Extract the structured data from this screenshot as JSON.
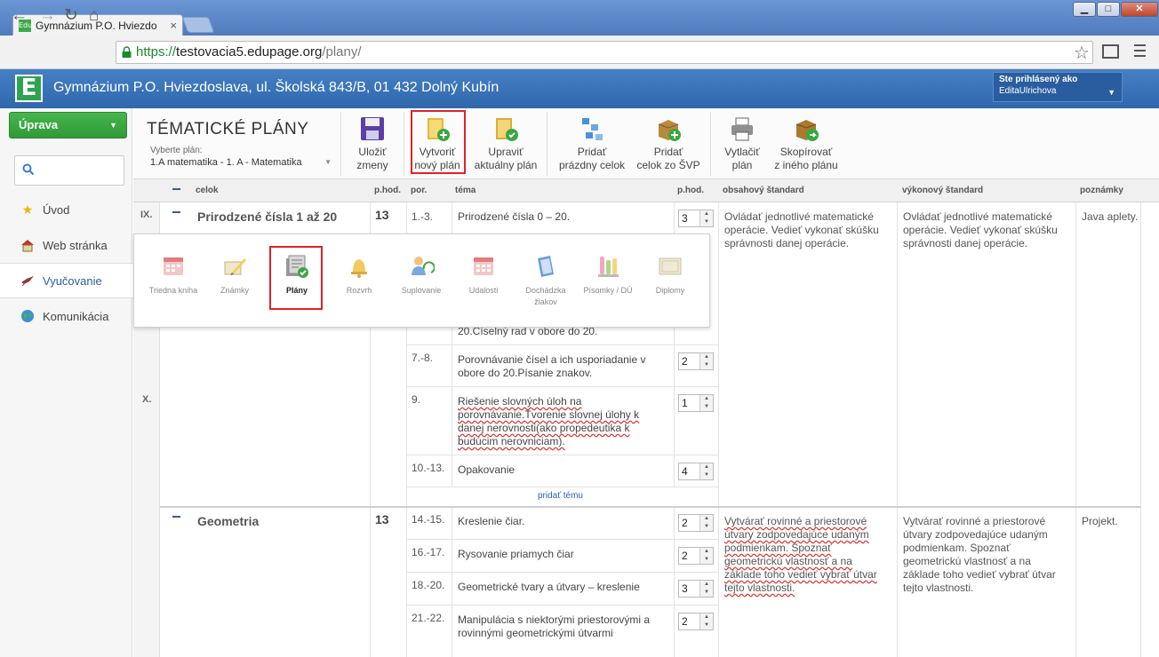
{
  "browser": {
    "tab_title": "Gymnázium P.O. Hviezdo",
    "tab_favicon": "Edu",
    "tab_close": "×",
    "url_scheme": "https://",
    "url_host": "testovacia5.edupage.org",
    "url_path": "/plany/",
    "win_min": "▁",
    "win_max": "□",
    "win_close": "✕"
  },
  "header": {
    "logo": "E",
    "school": "Gymnázium P.O. Hviezdoslava, ul. Školská 843/B, 01 432 Dolný Kubín",
    "user_label": "Ste prihlásený ako",
    "user_name": "EditaUlrichova"
  },
  "sidebar": {
    "uprava": "Úprava",
    "items": [
      {
        "label": "Úvod",
        "icon": "star-icon"
      },
      {
        "label": "Web stránka",
        "icon": "house-icon"
      },
      {
        "label": "Vyučovanie",
        "icon": "bird-icon"
      },
      {
        "label": "Komunikácia",
        "icon": "globe-icon"
      }
    ]
  },
  "page": {
    "title": "TÉMATICKÉ PLÁNY",
    "select_label": "Vyberte plán:",
    "select_value": "1.A matematika - 1. A - Matematika"
  },
  "toolbar": {
    "save": [
      "Uložiť",
      "zmeny"
    ],
    "new_plan": [
      "Vytvoriť",
      "nový plán"
    ],
    "edit_plan": [
      "Upraviť",
      "aktuálny plán"
    ],
    "add_empty": [
      "Pridať",
      "prázdny celok"
    ],
    "add_svp": [
      "Pridať",
      "celok zo ŠVP"
    ],
    "print": [
      "Vytlačiť",
      "plán"
    ],
    "copy": [
      "Skopírovať",
      "z iného plánu"
    ]
  },
  "table": {
    "headers": {
      "celok": "celok",
      "phod1": "p.hod.",
      "por": "por.",
      "tema": "téma",
      "phod2": "p.hod.",
      "obsah": "obsahový štandard",
      "vykon": "výkonový štandard",
      "pozn": "poznámky"
    },
    "weeks": [
      "IX.",
      "X."
    ],
    "unit1": {
      "name": "Prirodzené čísla 1 až 20",
      "hours": "13",
      "rows": [
        {
          "por": "1.-3.",
          "tema": "Prirodzené čísla 0 – 20.",
          "hod": "3"
        },
        {
          "por": "",
          "tema": "20.Číselný rad v obore do 20.",
          "hod": ""
        },
        {
          "por": "7.-8.",
          "tema": "Porovnávanie čísel a ich usporiadanie v obore do 20.Písanie znakov.",
          "hod": "2"
        },
        {
          "por": "9.",
          "tema": "Riešenie slovných úloh na porovnávanie.Tvorenie slovnej úlohy k danej nerovnosti(ako propedeutika k budúcim nerovniciam).",
          "hod": "1"
        },
        {
          "por": "10.-13.",
          "tema": "Opakovanie",
          "hod": "4"
        }
      ],
      "add_topic": "pridať tému",
      "obsah": "Ovládať jednotlivé matematické operácie. Vedieť vykonať skúšku správnosti danej operácie.",
      "vykon": "Ovládať jednotlivé matematické operácie. Vedieť vykonať skúšku správnosti danej operácie.",
      "pozn": "Java aplety."
    },
    "unit2": {
      "name": "Geometria",
      "hours": "13",
      "rows": [
        {
          "por": "14.-15.",
          "tema": "Kreslenie čiar.",
          "hod": "2"
        },
        {
          "por": "16.-17.",
          "tema": "Rysovanie priamych čiar",
          "hod": "2"
        },
        {
          "por": "18.-20.",
          "tema": "Geometrické tvary a útvary – kreslenie",
          "hod": "3"
        },
        {
          "por": "21.-22.",
          "tema": "Manipulácia s niektorými priestorovými a rovinnými geometrickými útvarmi",
          "hod": "2"
        }
      ],
      "obsah": "Vytvárať rovinné a priestorové útvary zodpovedajúce udaným podmienkam.   Spoznať geometrickú vlastnosť a na základe toho vedieť vybrať útvar tejto vlastnosti.",
      "vykon": "Vytvárať rovinné a priestorové útvary zodpovedajúce udaným podmienkam.   Spoznať geometrickú vlastnosť a na základe toho vedieť vybrať útvar tejto vlastnosti.",
      "pozn": "Projekt."
    }
  },
  "popup": {
    "items": [
      {
        "label": "Triedna kniha",
        "icon": "class-book-icon"
      },
      {
        "label": "Známky",
        "icon": "grades-icon"
      },
      {
        "label": "Plány",
        "icon": "plans-icon"
      },
      {
        "label": "Rozvrh",
        "icon": "bell-icon"
      },
      {
        "label": "Suplovanie",
        "icon": "substitution-icon"
      },
      {
        "label": "Udalosti",
        "icon": "calendar-icon"
      },
      {
        "label": "Dochádzka",
        "label2": "žiakov",
        "icon": "attendance-icon"
      },
      {
        "label": "Písomky / DÚ",
        "icon": "tests-icon"
      },
      {
        "label": "Diplomy",
        "icon": "diploma-icon"
      }
    ]
  },
  "colors": {
    "header_blue": "#3a73b8",
    "green_button": "#3aa742",
    "highlight_red": "#e0222a",
    "link_blue": "#2a64b6"
  }
}
